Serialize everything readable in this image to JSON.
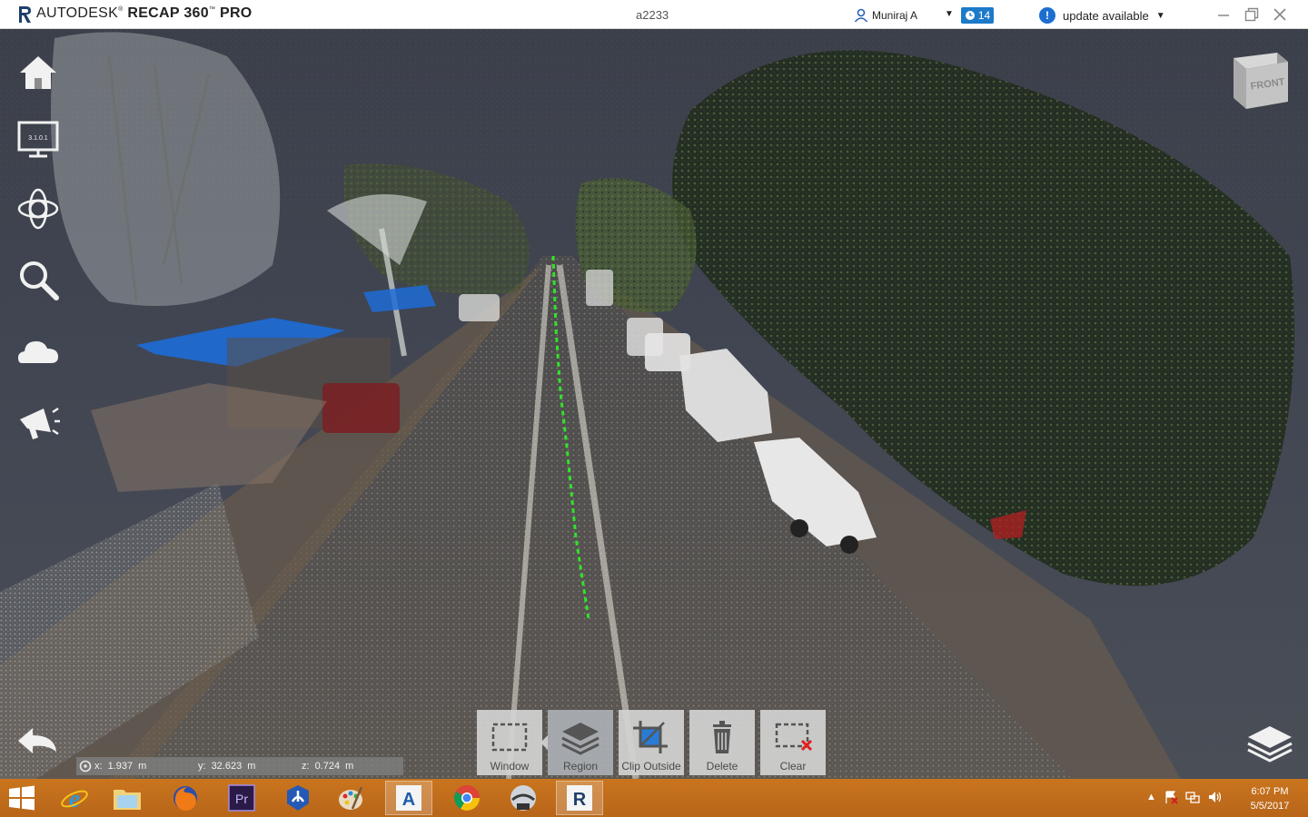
{
  "app": {
    "brand": "AUTODESK",
    "product": "RECAP 360",
    "edition": "PRO",
    "document_title": "a2233",
    "user_name": "Muniraj A",
    "notification_count": "14",
    "update_text": "update available"
  },
  "left_tools": [
    {
      "name": "home"
    },
    {
      "name": "display-settings",
      "badge": "3.1.0.1"
    },
    {
      "name": "navigation"
    },
    {
      "name": "search"
    },
    {
      "name": "cloud"
    },
    {
      "name": "announcements"
    }
  ],
  "viewcube": {
    "face": "FRONT"
  },
  "coordinates": {
    "x_label": "x:",
    "x_value": "1.937",
    "x_unit": "m",
    "y_label": "y:",
    "y_value": "32.623",
    "y_unit": "m",
    "z_label": "z:",
    "z_value": "0.724",
    "z_unit": "m"
  },
  "toolbar": {
    "window": "Window",
    "region": "Region",
    "clip_outside": "Clip Outside",
    "delete": "Delete",
    "clear": "Clear"
  },
  "taskbar": {
    "apps": [
      "internet-explorer",
      "file-explorer",
      "firefox",
      "premiere-pro",
      "autodesk-desktop-app",
      "paint",
      "autocad",
      "chrome",
      "recap-pro",
      "recap-360"
    ],
    "premiere_label": "Pr",
    "autocad_label": "A",
    "recap_label": "R",
    "time": "6:07 PM",
    "date": "5/5/2017"
  },
  "colors": {
    "viewport_bg": "#41454f",
    "accent_blue": "#1c7ac9",
    "taskbar": "#c06e1c",
    "clip_icon": "#2a7bd4",
    "clear_x": "#e02020"
  }
}
